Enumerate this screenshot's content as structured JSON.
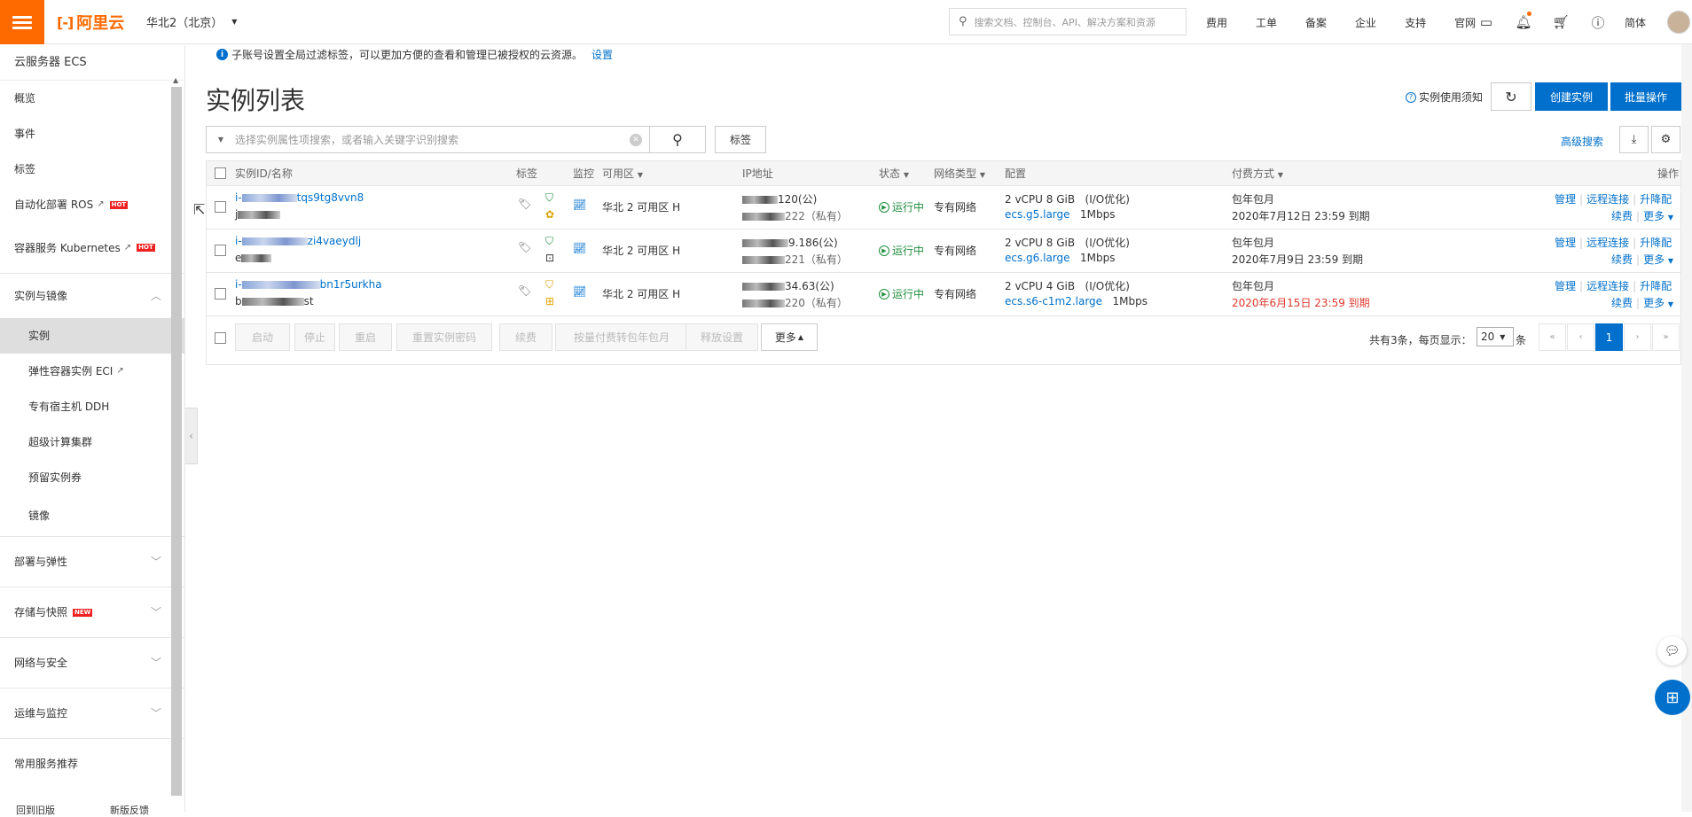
{
  "topbar": {
    "logo_text": "阿里云",
    "region": "华北2（北京）",
    "search_placeholder": "搜索文档、控制台、API、解决方案和资源",
    "links": [
      "费用",
      "工单",
      "备案",
      "企业",
      "支持",
      "官网"
    ],
    "lang": "简体",
    "icons": [
      "terminal-icon",
      "bell-icon",
      "cart-icon",
      "help-icon"
    ],
    "accent": "#ff6a00"
  },
  "sidebar": {
    "title": "云服务器 ECS",
    "items": [
      {
        "label": "概览"
      },
      {
        "label": "事件"
      },
      {
        "label": "标签"
      },
      {
        "label": "自动化部署 ROS",
        "badge": "HOT"
      },
      {
        "label": "容器服务 Kubernetes",
        "badge": "HOT"
      }
    ],
    "group_instances": "实例与镜像",
    "sub_items": [
      {
        "label": "实例"
      },
      {
        "label": "弹性容器实例 ECI"
      },
      {
        "label": "专有宿主机 DDH"
      },
      {
        "label": "超级计算集群"
      },
      {
        "label": "预留实例券"
      },
      {
        "label": "镜像"
      }
    ],
    "groups": [
      {
        "label": "部署与弹性"
      },
      {
        "label": "存储与快照",
        "badge": "NEW"
      },
      {
        "label": "网络与安全"
      },
      {
        "label": "运维与监控"
      }
    ],
    "recommend": "常用服务推荐",
    "footer": [
      "回到旧版",
      "新版反馈"
    ]
  },
  "notice": {
    "text": "子账号设置全局过滤标签，可以更加方便的查看和管理已被授权的云资源。",
    "link": "设置"
  },
  "page": {
    "title": "实例列表",
    "help": "实例使用须知",
    "create_btn": "创建实例",
    "batch_btn": "批量操作",
    "search_placeholder": "选择实例属性项搜索，或者输入关键字识别搜索",
    "tag_btn": "标签",
    "adv_search": "高级搜索",
    "brand_color": "#0070cc"
  },
  "table": {
    "headers": {
      "id": "实例ID/名称",
      "tag": "标签",
      "monitor": "监控",
      "zone": "可用区",
      "ip": "IP地址",
      "status": "状态",
      "network": "网络类型",
      "config": "配置",
      "billing": "付费方式",
      "ops": "操作"
    },
    "rows": [
      {
        "id_suffix": "tqs9tg8vvn8",
        "name_prefix": "j",
        "zone": "华北 2 可用区 H",
        "ip_public": "120(公)",
        "ip_private": "222（私有）",
        "status": "运行中",
        "network": "专有网络",
        "config": "2 vCPU 8 GiB",
        "optimized": "(I/O优化)",
        "spec": "ecs.g5.large",
        "bandwidth": "1Mbps",
        "billing": "包年包月",
        "expire": "2020年7月12日 23:59 到期",
        "expire_warn": false
      },
      {
        "id_suffix": "zi4vaeydlj",
        "name_prefix": "e",
        "zone": "华北 2 可用区 H",
        "ip_public": "9.186(公)",
        "ip_private": "221（私有）",
        "status": "运行中",
        "network": "专有网络",
        "config": "2 vCPU 8 GiB",
        "optimized": "(I/O优化)",
        "spec": "ecs.g6.large",
        "bandwidth": "1Mbps",
        "billing": "包年包月",
        "expire": "2020年7月9日 23:59 到期",
        "expire_warn": false
      },
      {
        "id_suffix": "bn1r5urkha",
        "name_prefix": "b",
        "name_suffix": "st",
        "zone": "华北 2 可用区 H",
        "ip_public": "34.63(公)",
        "ip_private": "220（私有）",
        "status": "运行中",
        "network": "专有网络",
        "config": "2 vCPU 4 GiB",
        "optimized": "(I/O优化)",
        "spec": "ecs.s6-c1m2.large",
        "bandwidth": "1Mbps",
        "billing": "包年包月",
        "expire": "2020年6月15日 23:59 到期",
        "expire_warn": true
      }
    ],
    "row_ops": {
      "manage": "管理",
      "remote": "远程连接",
      "upgrade": "升降配",
      "renew": "续费",
      "more": "更多"
    },
    "footer_buttons": [
      "启动",
      "停止",
      "重启",
      "重置实例密码",
      "续费",
      "按量付费转包年包月",
      "释放设置"
    ],
    "footer_more": "更多",
    "total_text": "共有3条，每页显示：",
    "page_size": "20",
    "page_size_suffix": "条",
    "current_page": "1"
  }
}
